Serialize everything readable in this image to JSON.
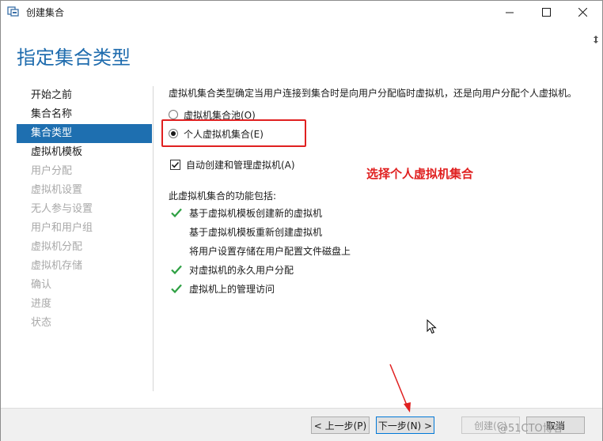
{
  "window": {
    "title": "创建集合"
  },
  "header": {
    "title": "指定集合类型"
  },
  "nav": {
    "items": [
      {
        "label": "开始之前",
        "state": "normal"
      },
      {
        "label": "集合名称",
        "state": "normal"
      },
      {
        "label": "集合类型",
        "state": "active"
      },
      {
        "label": "虚拟机模板",
        "state": "normal"
      },
      {
        "label": "用户分配",
        "state": "disabled"
      },
      {
        "label": "虚拟机设置",
        "state": "disabled"
      },
      {
        "label": "无人参与设置",
        "state": "disabled"
      },
      {
        "label": "用户和用户组",
        "state": "disabled"
      },
      {
        "label": "虚拟机分配",
        "state": "disabled"
      },
      {
        "label": "虚拟机存储",
        "state": "disabled"
      },
      {
        "label": "确认",
        "state": "disabled"
      },
      {
        "label": "进度",
        "state": "disabled"
      },
      {
        "label": "状态",
        "state": "disabled"
      }
    ]
  },
  "content": {
    "description": "虚拟机集合类型确定当用户连接到集合时是向用户分配临时虚拟机，还是向用户分配个人虚拟机。",
    "options": [
      {
        "label": "虚拟机集合池(O)",
        "selected": false
      },
      {
        "label": "个人虚拟机集合(E)",
        "selected": true
      }
    ],
    "auto_manage": {
      "label": "自动创建和管理虚拟机(A)",
      "checked": true
    },
    "annotation": "选择个人虚拟机集合",
    "features_title": "此虚拟机集合的功能包括:",
    "features": [
      {
        "label": "基于虚拟机模板创建新的虚拟机",
        "enabled": true
      },
      {
        "label": "基于虚拟机模板重新创建虚拟机",
        "enabled": false
      },
      {
        "label": "将用户设置存储在用户配置文件磁盘上",
        "enabled": false
      },
      {
        "label": "对虚拟机的永久用户分配",
        "enabled": true
      },
      {
        "label": "虚拟机上的管理访问",
        "enabled": true
      }
    ]
  },
  "footer": {
    "prev_label": "< 上一步(P)",
    "next_label": "下一步(N) >",
    "create_label": "创建(C)",
    "cancel_label": "取消"
  },
  "watermark": "@51CTO博客",
  "colors": {
    "accent": "#1e6fb0",
    "title": "#1f6cae",
    "annotation": "#e02020",
    "check": "#2ea043"
  }
}
